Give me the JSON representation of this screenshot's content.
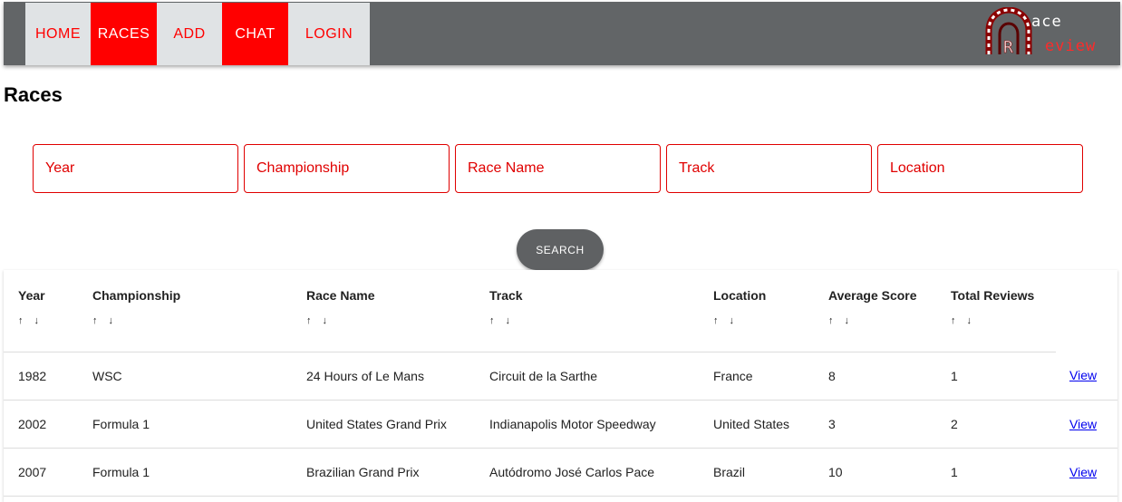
{
  "nav": {
    "items": [
      {
        "label": "HOME"
      },
      {
        "label": "RACES"
      },
      {
        "label": "ADD"
      },
      {
        "label": "CHAT"
      },
      {
        "label": "LOGIN"
      }
    ]
  },
  "logo": {
    "line1": "ace",
    "line2": "eview"
  },
  "page": {
    "title": "Races"
  },
  "filters": {
    "year_placeholder": "Year",
    "championship_placeholder": "Championship",
    "race_name_placeholder": "Race Name",
    "track_placeholder": "Track",
    "location_placeholder": "Location"
  },
  "search": {
    "label": "SEARCH"
  },
  "table": {
    "columns": [
      "Year",
      "Championship",
      "Race Name",
      "Track",
      "Location",
      "Average Score",
      "Total Reviews"
    ],
    "sort_up": "↑",
    "sort_down": "↓",
    "rows": [
      {
        "year": "1982",
        "championship": "WSC",
        "race_name": "24 Hours of Le Mans",
        "track": "Circuit de la Sarthe",
        "location": "France",
        "avg": "8",
        "total": "1",
        "action": "View"
      },
      {
        "year": "2002",
        "championship": "Formula 1",
        "race_name": "United States Grand Prix",
        "track": "Indianapolis Motor Speedway",
        "location": "United States",
        "avg": "3",
        "total": "2",
        "action": "View"
      },
      {
        "year": "2007",
        "championship": "Formula 1",
        "race_name": "Brazilian Grand Prix",
        "track": "Autódromo José Carlos Pace",
        "location": "Brazil",
        "avg": "10",
        "total": "1",
        "action": "View"
      }
    ]
  }
}
